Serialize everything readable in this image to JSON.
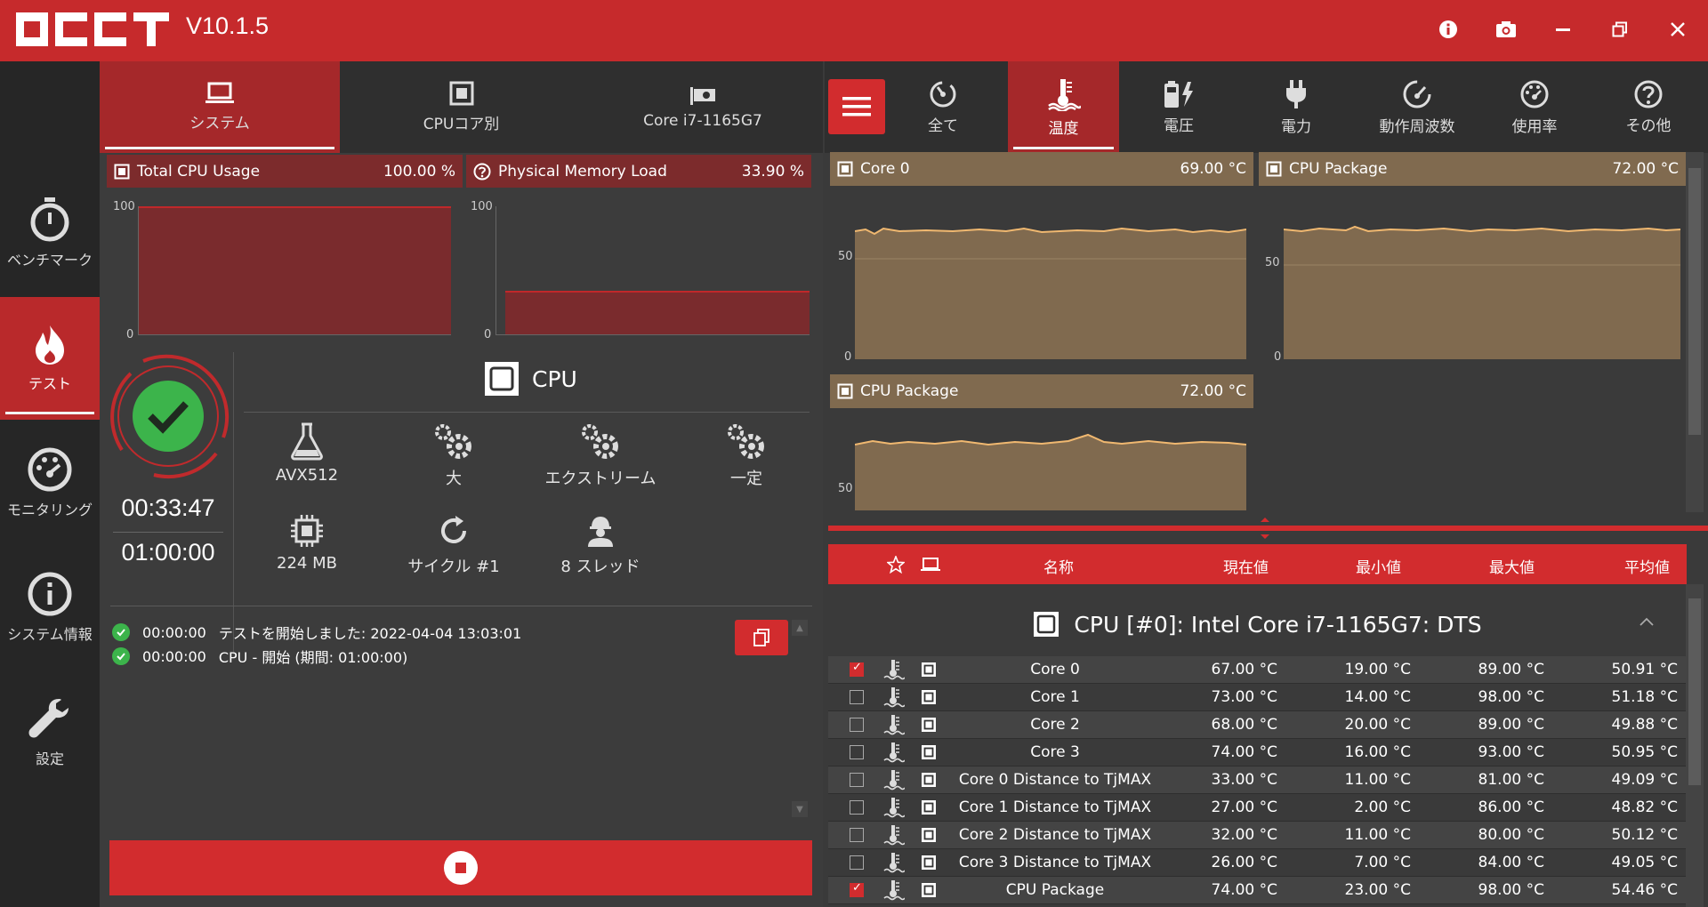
{
  "app": {
    "logo_text": "OCCT",
    "version": "V10.1.5"
  },
  "sidebar": {
    "items": [
      {
        "label": "ベンチマーク",
        "icon": "stopwatch-icon",
        "active": false
      },
      {
        "label": "テスト",
        "icon": "flame-icon",
        "active": true
      },
      {
        "label": "モニタリング",
        "icon": "gauge-icon",
        "active": false
      },
      {
        "label": "システム情報",
        "icon": "info-icon",
        "active": false
      },
      {
        "label": "設定",
        "icon": "wrench-icon",
        "active": false
      }
    ]
  },
  "left_tabs": [
    {
      "label": "システム",
      "icon": "laptop-icon",
      "active": true
    },
    {
      "label": "CPUコア別",
      "icon": "cpu-icon",
      "active": false
    },
    {
      "label": "Core i7-1165G7",
      "icon": "gpu-card-icon",
      "active": false
    }
  ],
  "cpu_usage": {
    "title": "Total CPU Usage",
    "value": "100.00 %",
    "y_max": "100",
    "y_min": "0",
    "level": 100
  },
  "memory_load": {
    "title": "Physical Memory Load",
    "value": "33.90 %",
    "y_max": "100",
    "y_min": "0",
    "level": 33.9
  },
  "status": {
    "state": "ok",
    "elapsed": "00:33:47",
    "total": "01:00:00"
  },
  "test": {
    "title": "CPU",
    "options": [
      {
        "label": "AVX512",
        "icon": "flask-icon"
      },
      {
        "label": "大",
        "icon": "gears-icon"
      },
      {
        "label": "エクストリーム",
        "icon": "gears-icon"
      },
      {
        "label": "一定",
        "icon": "gears-icon"
      },
      {
        "label": "224 MB",
        "icon": "chip-icon"
      },
      {
        "label": "サイクル #1",
        "icon": "refresh-icon"
      },
      {
        "label": "8 スレッド",
        "icon": "worker-icon"
      }
    ]
  },
  "log": [
    {
      "time": "00:00:00",
      "text": "テストを開始しました: 2022-04-04 13:03:01"
    },
    {
      "time": "00:00:00",
      "text": "CPU - 開始 (期間: 01:00:00)"
    }
  ],
  "right_tabs": [
    {
      "label": "全て",
      "icon": "dial-icon",
      "active": false
    },
    {
      "label": "温度",
      "icon": "thermometer-icon",
      "active": true
    },
    {
      "label": "電圧",
      "icon": "battery-bolt-icon",
      "active": false
    },
    {
      "label": "電力",
      "icon": "plug-icon",
      "active": false
    },
    {
      "label": "動作周波数",
      "icon": "speedometer-icon",
      "active": false
    },
    {
      "label": "使用率",
      "icon": "usage-gauge-icon",
      "active": false
    },
    {
      "label": "その他",
      "icon": "question-icon",
      "active": false
    }
  ],
  "temp_graphs": [
    {
      "title": "Core 0",
      "value": "69.00 °C",
      "tick_mid": "50",
      "tick_min": "0"
    },
    {
      "title": "CPU Package",
      "value": "72.00 °C",
      "tick_mid": "50",
      "tick_min": "0"
    },
    {
      "title": "CPU Package",
      "value": "72.00 °C",
      "tick_mid": "50"
    }
  ],
  "table": {
    "headers": {
      "name": "名称",
      "current": "現在値",
      "min": "最小値",
      "max": "最大値",
      "avg": "平均値"
    },
    "group": "CPU [#0]: Intel Core i7-1165G7: DTS",
    "rows": [
      {
        "checked": true,
        "name": "Core 0",
        "current": "67.00 °C",
        "min": "19.00 °C",
        "max": "89.00 °C",
        "avg": "50.91 °C"
      },
      {
        "checked": false,
        "name": "Core 1",
        "current": "73.00 °C",
        "min": "14.00 °C",
        "max": "98.00 °C",
        "avg": "51.18 °C"
      },
      {
        "checked": false,
        "name": "Core 2",
        "current": "68.00 °C",
        "min": "20.00 °C",
        "max": "89.00 °C",
        "avg": "49.88 °C"
      },
      {
        "checked": false,
        "name": "Core 3",
        "current": "74.00 °C",
        "min": "16.00 °C",
        "max": "93.00 °C",
        "avg": "50.95 °C"
      },
      {
        "checked": false,
        "name": "Core 0 Distance to TjMAX",
        "current": "33.00 °C",
        "min": "11.00 °C",
        "max": "81.00 °C",
        "avg": "49.09 °C"
      },
      {
        "checked": false,
        "name": "Core 1 Distance to TjMAX",
        "current": "27.00 °C",
        "min": "2.00 °C",
        "max": "86.00 °C",
        "avg": "48.82 °C"
      },
      {
        "checked": false,
        "name": "Core 2 Distance to TjMAX",
        "current": "32.00 °C",
        "min": "11.00 °C",
        "max": "80.00 °C",
        "avg": "50.12 °C"
      },
      {
        "checked": false,
        "name": "Core 3 Distance to TjMAX",
        "current": "26.00 °C",
        "min": "7.00 °C",
        "max": "84.00 °C",
        "avg": "49.05 °C"
      },
      {
        "checked": true,
        "name": "CPU Package",
        "current": "74.00 °C",
        "min": "23.00 °C",
        "max": "98.00 °C",
        "avg": "54.46 °C"
      }
    ]
  },
  "colors": {
    "brand_red": "#c62a2c",
    "ok_green": "#3cb44b",
    "temp_fill": "#806a4f",
    "temp_line": "#f0b870"
  }
}
